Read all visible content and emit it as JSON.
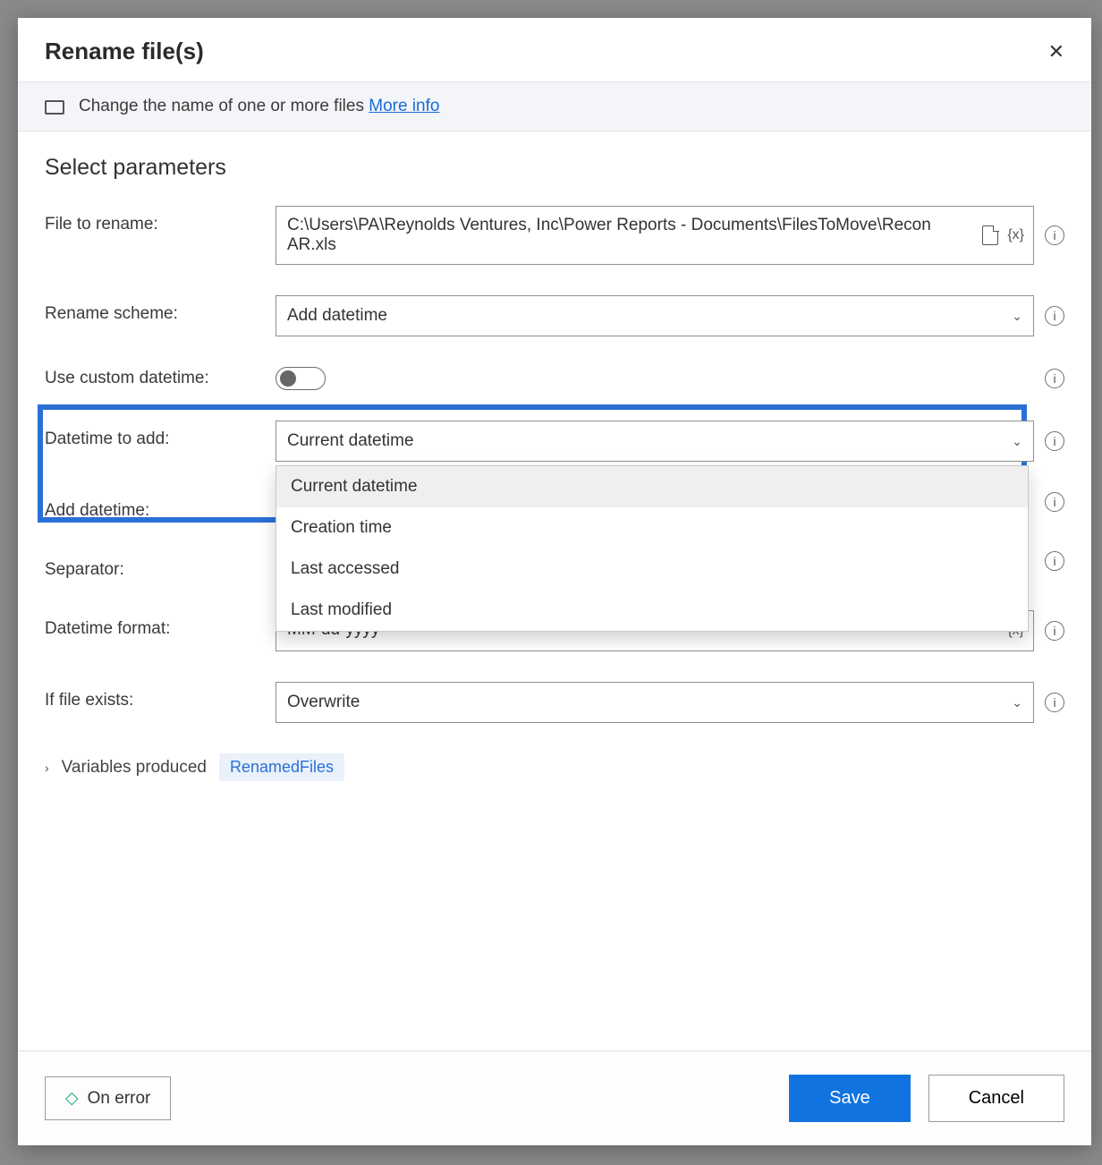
{
  "dialog": {
    "title": "Rename file(s)",
    "description": "Change the name of one or more files",
    "more_info": "More info"
  },
  "section_title": "Select parameters",
  "fields": {
    "file_to_rename": {
      "label": "File to rename:",
      "value": "C:\\Users\\PA\\Reynolds Ventures, Inc\\Power Reports - Documents\\FilesToMove\\ReconAR.xls"
    },
    "rename_scheme": {
      "label": "Rename scheme:",
      "value": "Add datetime"
    },
    "use_custom_datetime": {
      "label": "Use custom datetime:",
      "value": false
    },
    "datetime_to_add": {
      "label": "Datetime to add:",
      "value": "Current datetime",
      "options": [
        "Current datetime",
        "Creation time",
        "Last accessed",
        "Last modified"
      ]
    },
    "add_datetime": {
      "label": "Add datetime:"
    },
    "separator": {
      "label": "Separator:"
    },
    "datetime_format": {
      "label": "Datetime format:",
      "value": "MM-dd-yyyy"
    },
    "if_file_exists": {
      "label": "If file exists:",
      "value": "Overwrite"
    }
  },
  "variables": {
    "label": "Variables produced",
    "pill": "RenamedFiles"
  },
  "footer": {
    "on_error": "On error",
    "save": "Save",
    "cancel": "Cancel"
  },
  "var_token": "{x}"
}
